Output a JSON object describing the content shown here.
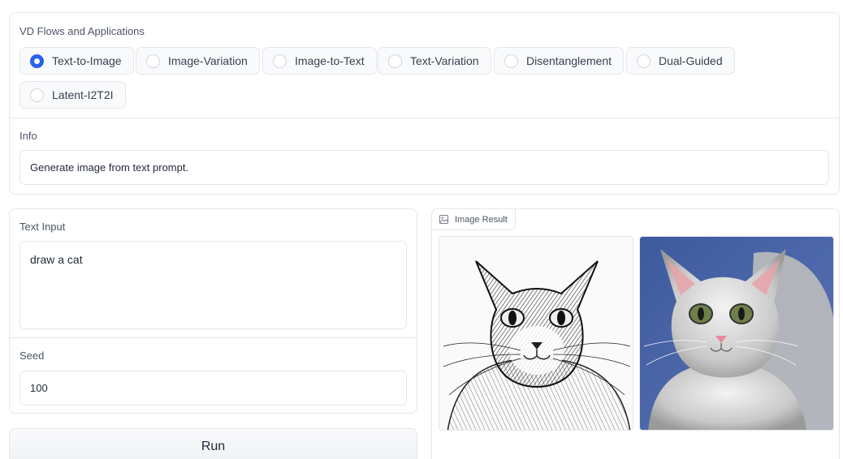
{
  "flows": {
    "label": "VD Flows and Applications",
    "options": [
      {
        "label": "Text-to-Image",
        "checked": true
      },
      {
        "label": "Image-Variation",
        "checked": false
      },
      {
        "label": "Image-to-Text",
        "checked": false
      },
      {
        "label": "Text-Variation",
        "checked": false
      },
      {
        "label": "Disentanglement",
        "checked": false
      },
      {
        "label": "Dual-Guided",
        "checked": false
      },
      {
        "label": "Latent-I2T2I",
        "checked": false
      }
    ]
  },
  "info": {
    "label": "Info",
    "text": "Generate image from text prompt."
  },
  "text_input": {
    "label": "Text Input",
    "value": "draw a cat"
  },
  "seed": {
    "label": "Seed",
    "value": "100"
  },
  "run_button": {
    "label": "Run"
  },
  "result": {
    "label": "Image Result",
    "images": [
      {
        "alt": "pencil sketch of a cat"
      },
      {
        "alt": "painted grey cat on blue background"
      }
    ]
  },
  "colors": {
    "accent": "#2563eb",
    "border": "#e5e7eb",
    "image2_bg": "#4d68a8"
  },
  "icons": [
    "radio-icon",
    "image-icon"
  ]
}
